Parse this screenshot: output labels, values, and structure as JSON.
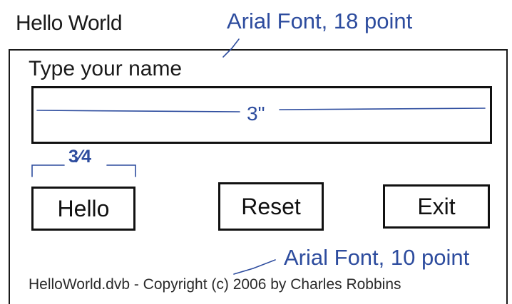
{
  "window": {
    "title": "Hello World"
  },
  "form": {
    "prompt_label": "Type your name",
    "name_input_value": "",
    "buttons": {
      "hello": "Hello",
      "reset": "Reset",
      "exit": "Exit"
    },
    "copyright": "HelloWorld.dvb - Copyright (c) 2006 by Charles Robbins"
  },
  "annotations": {
    "font_18": "Arial Font, 18 point",
    "font_10": "Arial Font, 10 point",
    "input_width": "3\"",
    "button_width": "3⁄4"
  },
  "colors": {
    "annotation": "#2d4c9e",
    "ink": "#1a1a1a",
    "background": "#ffffff"
  }
}
